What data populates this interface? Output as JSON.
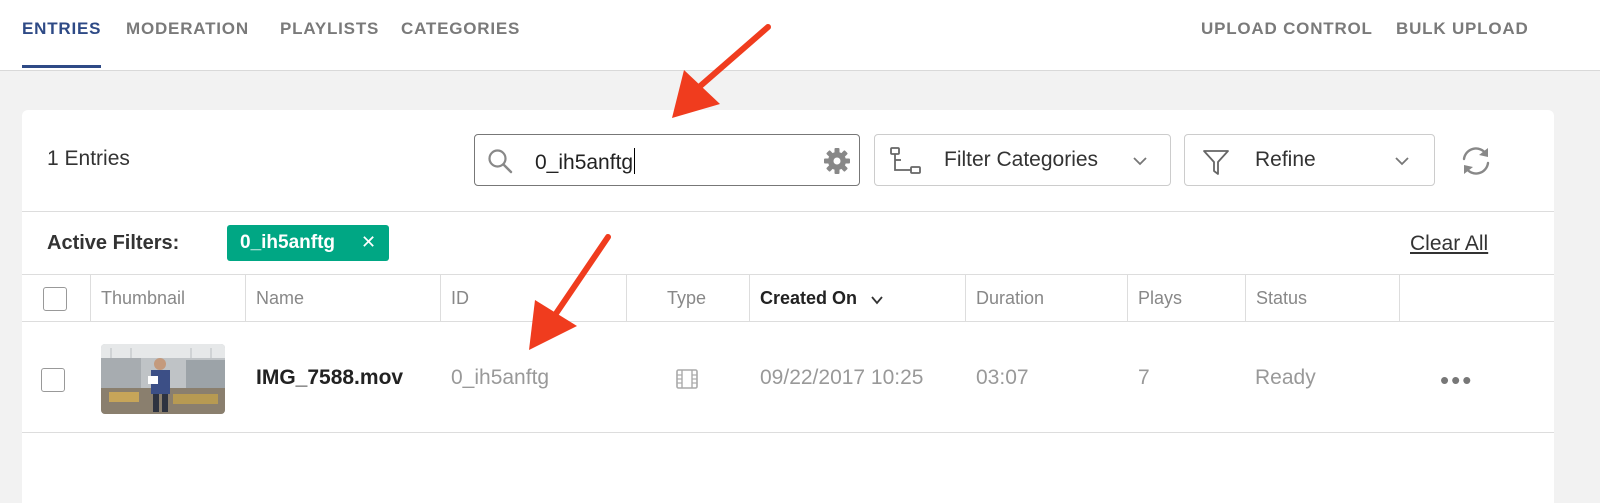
{
  "nav": {
    "tabs": [
      {
        "label": "ENTRIES",
        "active": true
      },
      {
        "label": "MODERATION"
      },
      {
        "label": "PLAYLISTS"
      },
      {
        "label": "CATEGORIES"
      }
    ],
    "right": [
      "UPLOAD CONTROL",
      "BULK UPLOAD"
    ]
  },
  "toolbar": {
    "entries_count": "1 Entries",
    "search_value": "0_ih5anftg",
    "filter_categories_label": "Filter Categories",
    "refine_label": "Refine"
  },
  "filters": {
    "label": "Active Filters:",
    "tags": [
      "0_ih5anftg"
    ],
    "clear_all": "Clear All"
  },
  "table": {
    "columns": [
      "Thumbnail",
      "Name",
      "ID",
      "Type",
      "Created On",
      "Duration",
      "Plays",
      "Status"
    ],
    "sorted_column": "Created On",
    "rows": [
      {
        "name": "IMG_7588.mov",
        "id": "0_ih5anftg",
        "type": "video-icon",
        "created_on": "09/22/2017 10:25",
        "duration": "03:07",
        "plays": "7",
        "status": "Ready"
      }
    ]
  },
  "colors": {
    "accent": "#2e4a86",
    "tag": "#00a784",
    "arrow": "#f03c1e"
  }
}
